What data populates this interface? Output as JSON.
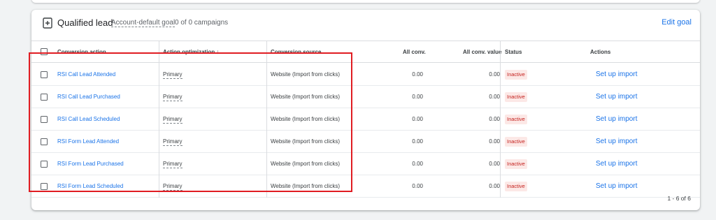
{
  "goal": {
    "title": "Qualified lead",
    "default_label": "Account-default goal",
    "campaigns": "0 of 0 campaigns",
    "edit_label": "Edit goal"
  },
  "table": {
    "headers": {
      "action": "Conversion action",
      "optimization": "Action optimization",
      "optimization_sort_icon": "↓",
      "source": "Conversion source",
      "all_conv": "All conv.",
      "all_conv_value": "All conv. value",
      "status": "Status",
      "actions": "Actions"
    },
    "rows": [
      {
        "name": "RSI Call Lead Attended",
        "optimization": "Primary",
        "source": "Website (Import from clicks)",
        "all_conv": "0.00",
        "all_conv_value": "0.00",
        "status": "Inactive",
        "action": "Set up import"
      },
      {
        "name": "RSI Call Lead Purchased",
        "optimization": "Primary",
        "source": "Website (Import from clicks)",
        "all_conv": "0.00",
        "all_conv_value": "0.00",
        "status": "Inactive",
        "action": "Set up import"
      },
      {
        "name": "RSI Call Lead Scheduled",
        "optimization": "Primary",
        "source": "Website (Import from clicks)",
        "all_conv": "0.00",
        "all_conv_value": "0.00",
        "status": "Inactive",
        "action": "Set up import"
      },
      {
        "name": "RSI Form Lead Attended",
        "optimization": "Primary",
        "source": "Website (Import from clicks)",
        "all_conv": "0.00",
        "all_conv_value": "0.00",
        "status": "Inactive",
        "action": "Set up import"
      },
      {
        "name": "RSI Form Lead Purchased",
        "optimization": "Primary",
        "source": "Website (Import from clicks)",
        "all_conv": "0.00",
        "all_conv_value": "0.00",
        "status": "Inactive",
        "action": "Set up import"
      },
      {
        "name": "RSI Form Lead Scheduled",
        "optimization": "Primary",
        "source": "Website (Import from clicks)",
        "all_conv": "0.00",
        "all_conv_value": "0.00",
        "status": "Inactive",
        "action": "Set up import"
      }
    ]
  },
  "pagination": "1 - 6 of 6",
  "colors": {
    "link": "#1a73e8",
    "inactive_text": "#c5221f",
    "inactive_bg": "#fce8e6",
    "highlight": "#e01c22"
  }
}
